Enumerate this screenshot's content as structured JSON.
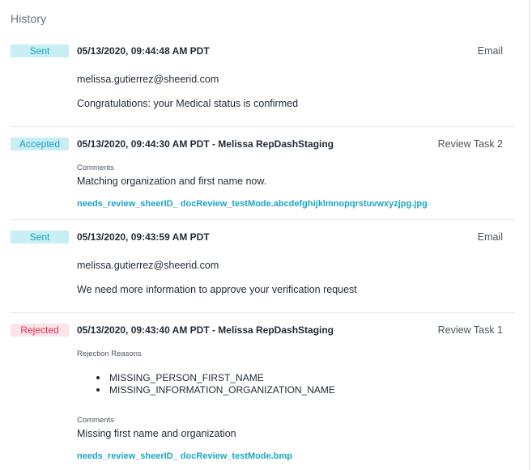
{
  "history": {
    "title": "History",
    "entries": [
      {
        "status": "Sent",
        "timestamp": "05/13/2020, 09:44:48 AM PDT",
        "kind": "Email",
        "recipient": "melissa.gutierrez@sheerid.com",
        "message": "Congratulations: your Medical status is confirmed"
      },
      {
        "status": "Accepted",
        "timestamp": "05/13/2020, 09:44:30 AM PDT - Melissa RepDashStaging",
        "kind": "Review Task 2",
        "comments_label": "Comments",
        "comment": "Matching organization and first name now.",
        "file": "needs_review_sheerID_ docReview_testMode.abcdefghijklmnopqrstuvwxyzjpg.jpg"
      },
      {
        "status": "Sent",
        "timestamp": "05/13/2020, 09:43:59 AM PDT",
        "kind": "Email",
        "recipient": "melissa.gutierrez@sheerid.com",
        "message": "We need more information to approve your verification request"
      },
      {
        "status": "Rejected",
        "timestamp": "05/13/2020, 09:43:40 AM PDT - Melissa RepDashStaging",
        "kind": "Review Task 1",
        "reasons_label": "Rejection Reasons",
        "reasons": [
          "MISSING_PERSON_FIRST_NAME",
          "MISSING_INFORMATION_ORGANIZATION_NAME"
        ],
        "comments_label": "Comments",
        "comment": "Missing first name and organization",
        "file": "needs_review_sheerID_ docReview_testMode.bmp"
      }
    ]
  },
  "colors": {
    "badge_info_bg": "#c8eef6",
    "badge_info_text": "#1e9fbd",
    "badge_rejected_bg": "#fce3e8",
    "badge_rejected_text": "#d9334f",
    "link": "#1aa6c4"
  }
}
